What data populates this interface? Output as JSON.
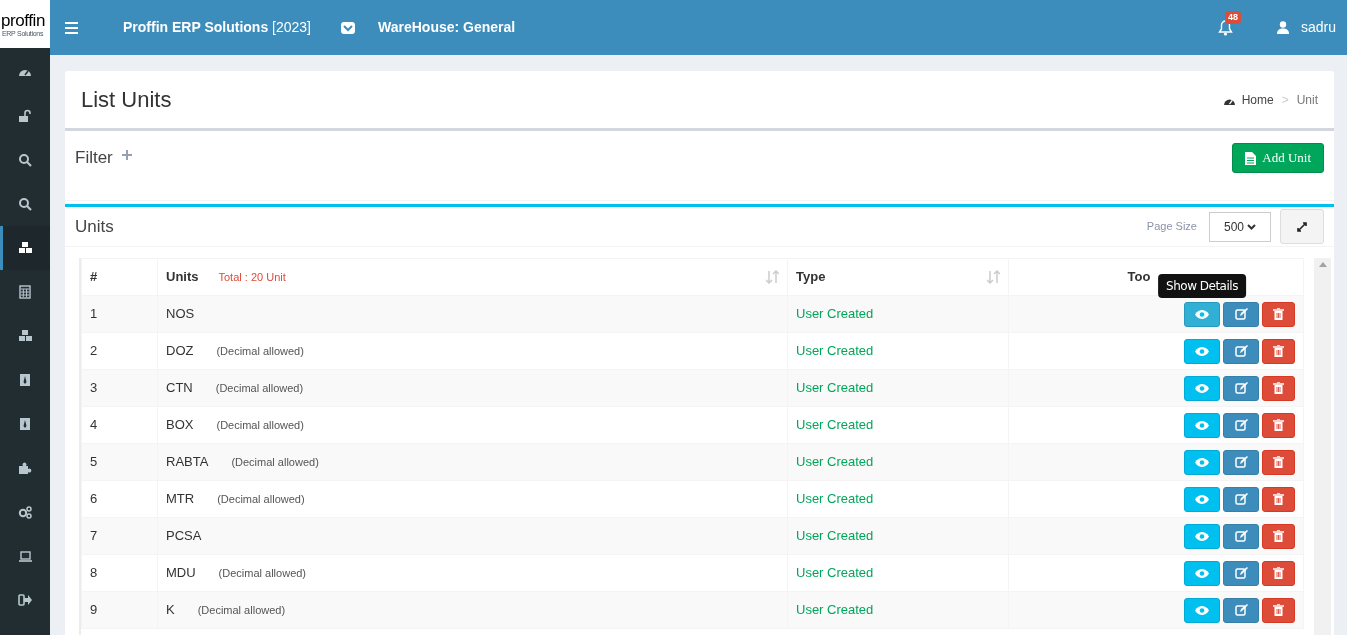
{
  "brand": {
    "logo": "proffin",
    "logo_sub": "ERP Solutions"
  },
  "topbar": {
    "app_title": "Proffin ERP Solutions",
    "year": "[2023]",
    "warehouse": "WareHouse: General",
    "notifications": "48",
    "user": "sadru"
  },
  "sidebar": {
    "items": [
      {
        "selected": false
      },
      {
        "selected": false
      },
      {
        "selected": false
      },
      {
        "selected": false
      },
      {
        "selected": true
      },
      {
        "selected": false
      },
      {
        "selected": false
      },
      {
        "selected": false
      },
      {
        "selected": false
      },
      {
        "selected": false
      },
      {
        "selected": false
      },
      {
        "selected": false
      },
      {
        "selected": false
      }
    ]
  },
  "page": {
    "title": "List Units",
    "breadcrumb": [
      "Home",
      "Unit"
    ],
    "separator": ">"
  },
  "filter": {
    "title": "Filter",
    "add_button": "Add Unit"
  },
  "units": {
    "title": "Units",
    "page_size_label": "Page Size",
    "page_size": "500",
    "columns": [
      "#",
      "Units",
      "Type",
      "Too"
    ],
    "total": "Total : 20 Unit",
    "rows": [
      {
        "num": "1",
        "unit": "NOS",
        "type": "User Created",
        "tooltip": "Show Details"
      },
      {
        "num": "2",
        "unit": "DOZ",
        "note": "(Decimal allowed)",
        "type": "User Created"
      },
      {
        "num": "3",
        "unit": "CTN",
        "note": "(Decimal allowed)",
        "type": "User Created"
      },
      {
        "num": "4",
        "unit": "BOX",
        "note": "(Decimal allowed)",
        "type": "User Created"
      },
      {
        "num": "5",
        "unit": "RABTA",
        "note": "(Decimal allowed)",
        "type": "User Created"
      },
      {
        "num": "6",
        "unit": "MTR",
        "note": "(Decimal allowed)",
        "type": "User Created"
      },
      {
        "num": "7",
        "unit": "PCSA",
        "type": "User Created"
      },
      {
        "num": "8",
        "unit": "MDU",
        "note": "(Decimal allowed)",
        "type": "User Created"
      },
      {
        "num": "9",
        "unit": "K",
        "note": "(Decimal allowed)",
        "type": "User Created"
      }
    ]
  }
}
